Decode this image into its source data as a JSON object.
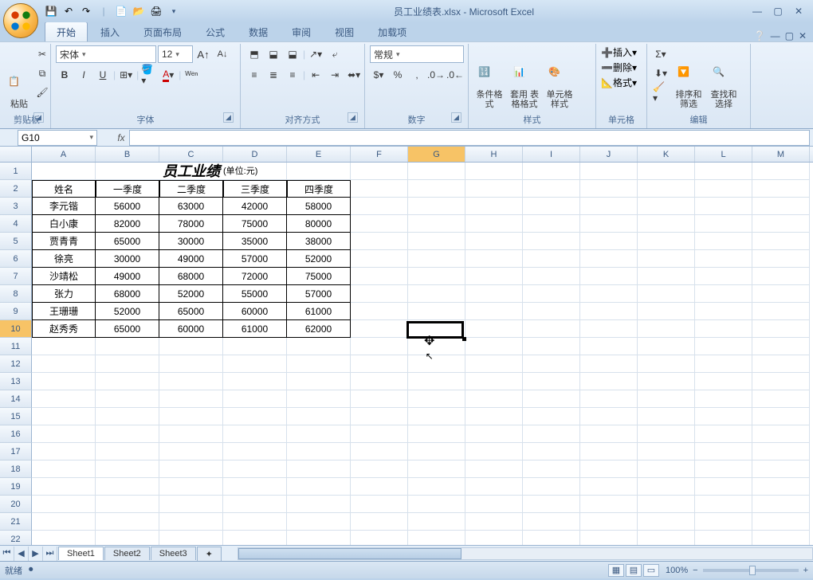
{
  "titlebar": {
    "filename": "员工业绩表.xlsx",
    "app": "Microsoft Excel"
  },
  "qat": {
    "save": "save",
    "undo": "undo",
    "redo": "redo",
    "new": "new",
    "open": "open",
    "quickprint": "quickprint"
  },
  "tabs": [
    "开始",
    "插入",
    "页面布局",
    "公式",
    "数据",
    "审阅",
    "视图",
    "加载项"
  ],
  "ribbon": {
    "clipboard": {
      "paste": "粘贴",
      "label": "剪贴板"
    },
    "font": {
      "name": "宋体",
      "size": "12",
      "label": "字体"
    },
    "align": {
      "label": "对齐方式"
    },
    "number": {
      "format": "常规",
      "label": "数字"
    },
    "styles": {
      "cond": "条件格式",
      "table": "套用\n表格格式",
      "cell": "单元格\n样式",
      "label": "样式"
    },
    "cells": {
      "insert": "插入",
      "delete": "删除",
      "format": "格式",
      "label": "单元格"
    },
    "editing": {
      "sort": "排序和\n筛选",
      "find": "查找和\n选择",
      "label": "编辑"
    }
  },
  "namebox": "G10",
  "columns": [
    "A",
    "B",
    "C",
    "D",
    "E",
    "F",
    "G",
    "H",
    "I",
    "J",
    "K",
    "L",
    "M"
  ],
  "active_col": "G",
  "active_row": 10,
  "data": {
    "title": "员工业绩表",
    "unit": "(单位:元)",
    "headers": [
      "姓名",
      "一季度",
      "二季度",
      "三季度",
      "四季度"
    ],
    "rows": [
      [
        "李元锴",
        "56000",
        "63000",
        "42000",
        "58000"
      ],
      [
        "白小康",
        "82000",
        "78000",
        "75000",
        "80000"
      ],
      [
        "贾青青",
        "65000",
        "30000",
        "35000",
        "38000"
      ],
      [
        "徐亮",
        "30000",
        "49000",
        "57000",
        "52000"
      ],
      [
        "沙靖松",
        "49000",
        "68000",
        "72000",
        "75000"
      ],
      [
        "张力",
        "68000",
        "52000",
        "55000",
        "57000"
      ],
      [
        "王珊珊",
        "52000",
        "65000",
        "60000",
        "61000"
      ],
      [
        "赵秀秀",
        "65000",
        "60000",
        "61000",
        "62000"
      ]
    ]
  },
  "sheets": [
    "Sheet1",
    "Sheet2",
    "Sheet3"
  ],
  "status": {
    "ready": "就绪",
    "zoom": "100%"
  }
}
